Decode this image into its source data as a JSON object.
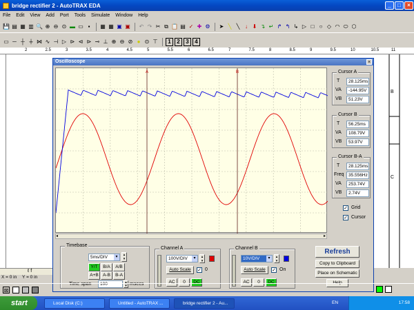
{
  "window": {
    "title": "bridge rectifier 2 - AutoTRAX EDA"
  },
  "menu": [
    "File",
    "Edit",
    "View",
    "Add",
    "Port",
    "Tools",
    "Simulate",
    "Window",
    "Help"
  ],
  "toolbar3_numbers": [
    "1",
    "2",
    "3",
    "4"
  ],
  "osc": {
    "title": "Oscilloscope",
    "cursor_a_marker": "A",
    "cursor_b_marker": "B",
    "cursorA": {
      "title": "Cursor A",
      "T_label": "T",
      "T": "28.125ms",
      "VA_label": "VA",
      "VA": "-144.95V",
      "VB_label": "VB",
      "VB": "51.23V"
    },
    "cursorB": {
      "title": "Cursor B",
      "T_label": "T",
      "T": "56.25ms",
      "VA_label": "VA",
      "VA": "108.79V",
      "VB_label": "VB",
      "VB": "53.97V"
    },
    "cursorBA": {
      "title": "Cursor B-A",
      "T_label": "T",
      "T": "28.125ms",
      "Freq_label": "Freq",
      "Freq": "35.556Hz",
      "VA_label": "VA",
      "VA": "253.74V",
      "VB_label": "VB",
      "VB": "2.74V"
    },
    "grid_label": "Grid",
    "cursor_label": "Cursor",
    "timebase": {
      "title": "Timebase",
      "value": "5ms/DIV",
      "modes": [
        "Y/T",
        "B/A",
        "A/B",
        "A+B",
        "A-B",
        "B-A"
      ],
      "span_label": "Time span",
      "span_value": "100",
      "span_unit": "msecs"
    },
    "channelA": {
      "title": "Channel A",
      "value": "100V/DIV",
      "autoscale": "Auto Scale",
      "zero": "0",
      "ac": "AC",
      "offset_value": "0",
      "dc": "DC",
      "color": "#e00000"
    },
    "channelB": {
      "title": "Channel B",
      "value": "10V/DIV",
      "autoscale": "Auto Scale",
      "on": "On",
      "ac": "AC",
      "offset_value": "0",
      "dc": "DC",
      "color": "#0000e0"
    },
    "buttons": {
      "refresh": "Refresh",
      "copy": "Copy to Clipboard",
      "place": "Place on Schematic",
      "help": "Help"
    }
  },
  "ruler_marks": [
    "2",
    "2.5",
    "3",
    "3.5",
    "4",
    "4.5",
    "5",
    "5.5",
    "6",
    "6.5",
    "7",
    "7.5",
    "8",
    "8.5",
    "9",
    "9.5",
    "10",
    "10.5",
    "11"
  ],
  "status": {
    "x": "X = 0 in",
    "y": "Y = 0 in"
  },
  "taskbar": {
    "start": "start",
    "tasks": [
      "Local Disk (C:)",
      "Untitled - AutoTRAX ...",
      "bridge rectifier 2 - Au..."
    ],
    "lang": "EN",
    "time": "17:58"
  },
  "waveforms": {
    "channel_a": {
      "description": "sinusoid",
      "amplitude_divs": 2.2,
      "period_ms": 28.125
    },
    "channel_b": {
      "description": "rectified ripple",
      "level_divs": 3.15
    }
  }
}
